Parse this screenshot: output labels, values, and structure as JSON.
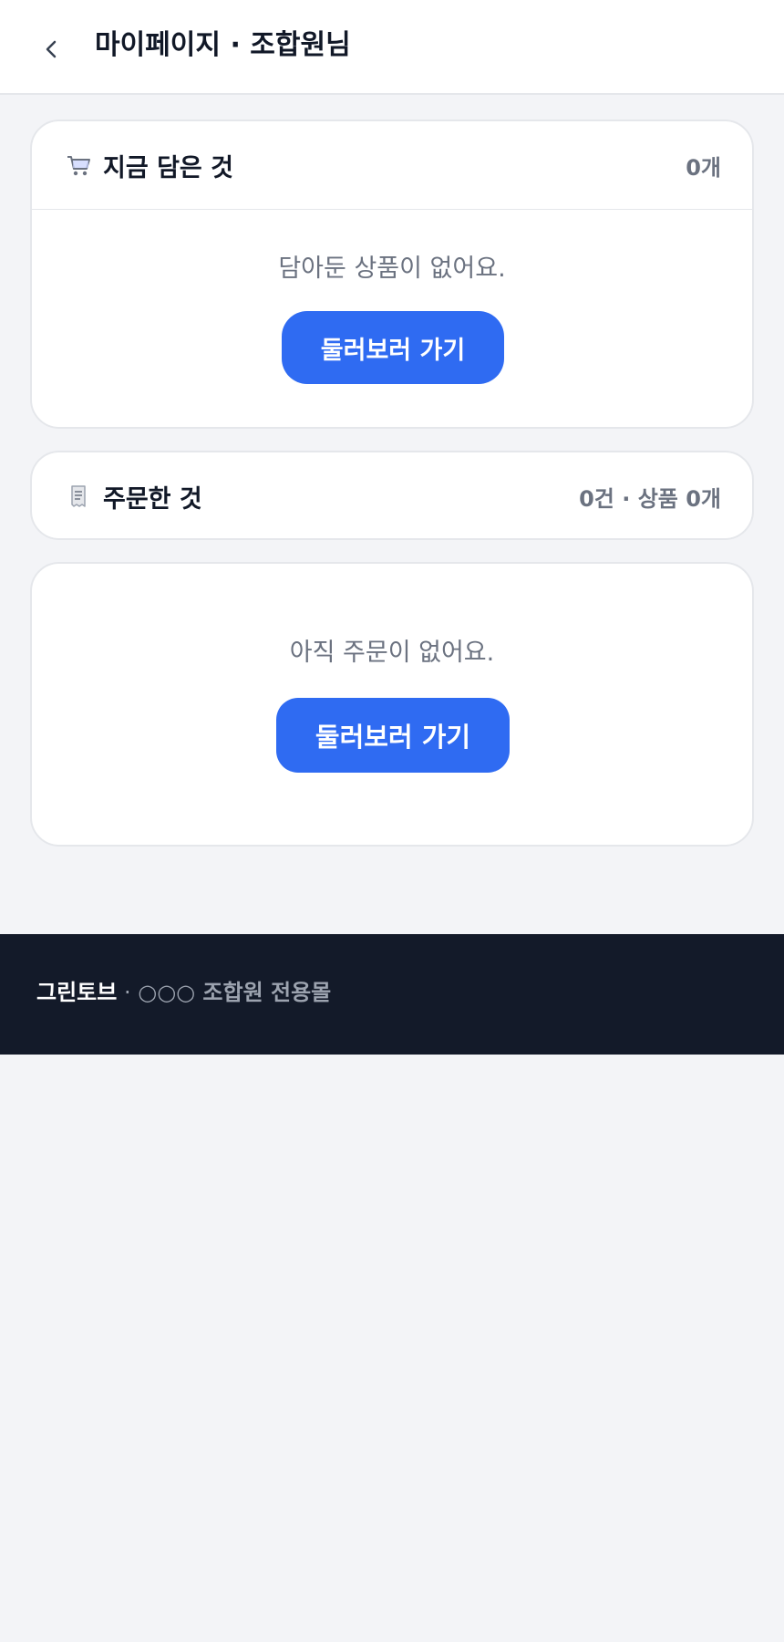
{
  "header": {
    "back_icon": "chevron-left-icon",
    "title": "마이페이지 · 조합원님"
  },
  "cart": {
    "icon": "shopping-cart-icon",
    "title": "지금 담은 것",
    "count": "0개",
    "empty_text": "담아둔 상품이 없어요.",
    "cta_label": "둘러보러 가기"
  },
  "orders": {
    "icon": "receipt-icon",
    "title": "주문한 것",
    "count": "0건 · 상품 0개",
    "empty_text": "아직 주문이 없어요.",
    "cta_label": "둘러보러 가기"
  },
  "footer": {
    "brand": "그린토브",
    "separator": "·",
    "text": "○○○ 조합원 전용몰"
  },
  "colors": {
    "accent": "#2f6bf2",
    "footer_bg": "#131a29",
    "page_bg": "#f3f4f7"
  }
}
